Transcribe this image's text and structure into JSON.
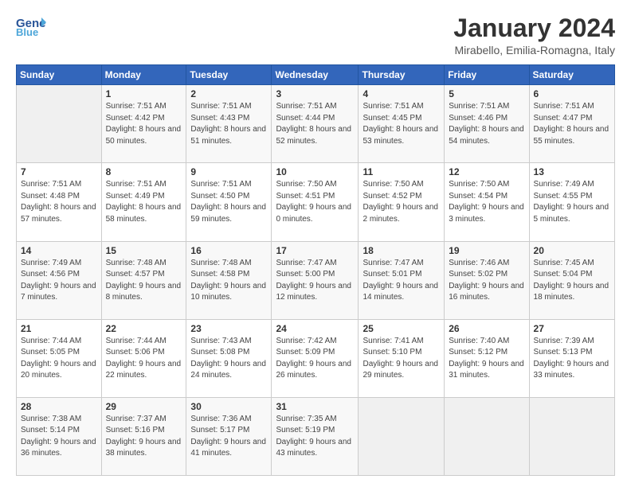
{
  "logo": {
    "line1": "General",
    "line2": "Blue"
  },
  "title": "January 2024",
  "location": "Mirabello, Emilia-Romagna, Italy",
  "weekdays": [
    "Sunday",
    "Monday",
    "Tuesday",
    "Wednesday",
    "Thursday",
    "Friday",
    "Saturday"
  ],
  "rows": [
    [
      {
        "day": "",
        "sunrise": "",
        "sunset": "",
        "daylight": ""
      },
      {
        "day": "1",
        "sunrise": "Sunrise: 7:51 AM",
        "sunset": "Sunset: 4:42 PM",
        "daylight": "Daylight: 8 hours and 50 minutes."
      },
      {
        "day": "2",
        "sunrise": "Sunrise: 7:51 AM",
        "sunset": "Sunset: 4:43 PM",
        "daylight": "Daylight: 8 hours and 51 minutes."
      },
      {
        "day": "3",
        "sunrise": "Sunrise: 7:51 AM",
        "sunset": "Sunset: 4:44 PM",
        "daylight": "Daylight: 8 hours and 52 minutes."
      },
      {
        "day": "4",
        "sunrise": "Sunrise: 7:51 AM",
        "sunset": "Sunset: 4:45 PM",
        "daylight": "Daylight: 8 hours and 53 minutes."
      },
      {
        "day": "5",
        "sunrise": "Sunrise: 7:51 AM",
        "sunset": "Sunset: 4:46 PM",
        "daylight": "Daylight: 8 hours and 54 minutes."
      },
      {
        "day": "6",
        "sunrise": "Sunrise: 7:51 AM",
        "sunset": "Sunset: 4:47 PM",
        "daylight": "Daylight: 8 hours and 55 minutes."
      }
    ],
    [
      {
        "day": "7",
        "sunrise": "Sunrise: 7:51 AM",
        "sunset": "Sunset: 4:48 PM",
        "daylight": "Daylight: 8 hours and 57 minutes."
      },
      {
        "day": "8",
        "sunrise": "Sunrise: 7:51 AM",
        "sunset": "Sunset: 4:49 PM",
        "daylight": "Daylight: 8 hours and 58 minutes."
      },
      {
        "day": "9",
        "sunrise": "Sunrise: 7:51 AM",
        "sunset": "Sunset: 4:50 PM",
        "daylight": "Daylight: 8 hours and 59 minutes."
      },
      {
        "day": "10",
        "sunrise": "Sunrise: 7:50 AM",
        "sunset": "Sunset: 4:51 PM",
        "daylight": "Daylight: 9 hours and 0 minutes."
      },
      {
        "day": "11",
        "sunrise": "Sunrise: 7:50 AM",
        "sunset": "Sunset: 4:52 PM",
        "daylight": "Daylight: 9 hours and 2 minutes."
      },
      {
        "day": "12",
        "sunrise": "Sunrise: 7:50 AM",
        "sunset": "Sunset: 4:54 PM",
        "daylight": "Daylight: 9 hours and 3 minutes."
      },
      {
        "day": "13",
        "sunrise": "Sunrise: 7:49 AM",
        "sunset": "Sunset: 4:55 PM",
        "daylight": "Daylight: 9 hours and 5 minutes."
      }
    ],
    [
      {
        "day": "14",
        "sunrise": "Sunrise: 7:49 AM",
        "sunset": "Sunset: 4:56 PM",
        "daylight": "Daylight: 9 hours and 7 minutes."
      },
      {
        "day": "15",
        "sunrise": "Sunrise: 7:48 AM",
        "sunset": "Sunset: 4:57 PM",
        "daylight": "Daylight: 9 hours and 8 minutes."
      },
      {
        "day": "16",
        "sunrise": "Sunrise: 7:48 AM",
        "sunset": "Sunset: 4:58 PM",
        "daylight": "Daylight: 9 hours and 10 minutes."
      },
      {
        "day": "17",
        "sunrise": "Sunrise: 7:47 AM",
        "sunset": "Sunset: 5:00 PM",
        "daylight": "Daylight: 9 hours and 12 minutes."
      },
      {
        "day": "18",
        "sunrise": "Sunrise: 7:47 AM",
        "sunset": "Sunset: 5:01 PM",
        "daylight": "Daylight: 9 hours and 14 minutes."
      },
      {
        "day": "19",
        "sunrise": "Sunrise: 7:46 AM",
        "sunset": "Sunset: 5:02 PM",
        "daylight": "Daylight: 9 hours and 16 minutes."
      },
      {
        "day": "20",
        "sunrise": "Sunrise: 7:45 AM",
        "sunset": "Sunset: 5:04 PM",
        "daylight": "Daylight: 9 hours and 18 minutes."
      }
    ],
    [
      {
        "day": "21",
        "sunrise": "Sunrise: 7:44 AM",
        "sunset": "Sunset: 5:05 PM",
        "daylight": "Daylight: 9 hours and 20 minutes."
      },
      {
        "day": "22",
        "sunrise": "Sunrise: 7:44 AM",
        "sunset": "Sunset: 5:06 PM",
        "daylight": "Daylight: 9 hours and 22 minutes."
      },
      {
        "day": "23",
        "sunrise": "Sunrise: 7:43 AM",
        "sunset": "Sunset: 5:08 PM",
        "daylight": "Daylight: 9 hours and 24 minutes."
      },
      {
        "day": "24",
        "sunrise": "Sunrise: 7:42 AM",
        "sunset": "Sunset: 5:09 PM",
        "daylight": "Daylight: 9 hours and 26 minutes."
      },
      {
        "day": "25",
        "sunrise": "Sunrise: 7:41 AM",
        "sunset": "Sunset: 5:10 PM",
        "daylight": "Daylight: 9 hours and 29 minutes."
      },
      {
        "day": "26",
        "sunrise": "Sunrise: 7:40 AM",
        "sunset": "Sunset: 5:12 PM",
        "daylight": "Daylight: 9 hours and 31 minutes."
      },
      {
        "day": "27",
        "sunrise": "Sunrise: 7:39 AM",
        "sunset": "Sunset: 5:13 PM",
        "daylight": "Daylight: 9 hours and 33 minutes."
      }
    ],
    [
      {
        "day": "28",
        "sunrise": "Sunrise: 7:38 AM",
        "sunset": "Sunset: 5:14 PM",
        "daylight": "Daylight: 9 hours and 36 minutes."
      },
      {
        "day": "29",
        "sunrise": "Sunrise: 7:37 AM",
        "sunset": "Sunset: 5:16 PM",
        "daylight": "Daylight: 9 hours and 38 minutes."
      },
      {
        "day": "30",
        "sunrise": "Sunrise: 7:36 AM",
        "sunset": "Sunset: 5:17 PM",
        "daylight": "Daylight: 9 hours and 41 minutes."
      },
      {
        "day": "31",
        "sunrise": "Sunrise: 7:35 AM",
        "sunset": "Sunset: 5:19 PM",
        "daylight": "Daylight: 9 hours and 43 minutes."
      },
      {
        "day": "",
        "sunrise": "",
        "sunset": "",
        "daylight": ""
      },
      {
        "day": "",
        "sunrise": "",
        "sunset": "",
        "daylight": ""
      },
      {
        "day": "",
        "sunrise": "",
        "sunset": "",
        "daylight": ""
      }
    ]
  ]
}
